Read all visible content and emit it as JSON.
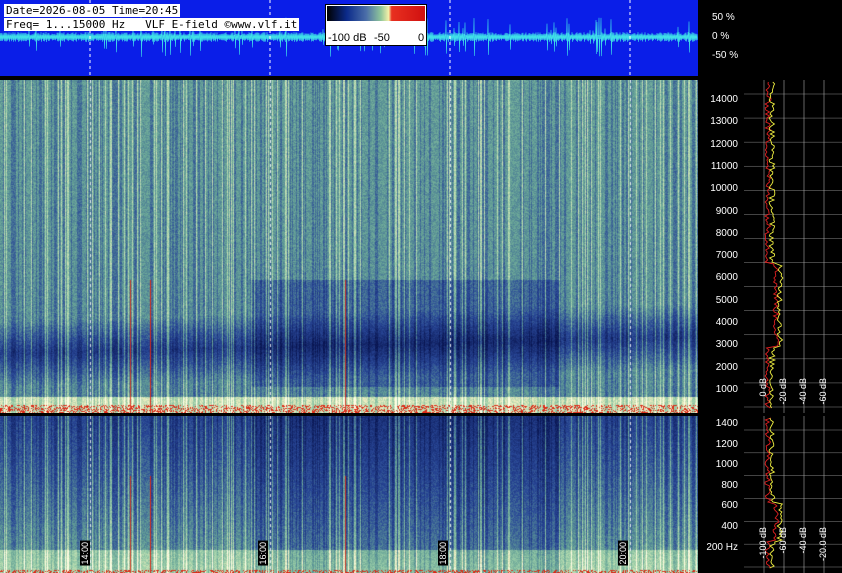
{
  "header": {
    "line1": "Date=2026-08-05 Time=20:45",
    "line2": "Freq= 1...15000 Hz   VLF E-field ©www.vlf.it"
  },
  "colorbar": {
    "labels": [
      "-100 dB",
      "-50",
      "0"
    ]
  },
  "waveform": {
    "scale_labels": [
      "50 %",
      "0 %",
      "-50 %"
    ]
  },
  "top_spectrogram": {
    "freq_ticks": [
      "14000",
      "13000",
      "12000",
      "11000",
      "10000",
      "9000",
      "8000",
      "7000",
      "6000",
      "5000",
      "4000",
      "3000",
      "2000",
      "1000"
    ],
    "db_labels": [
      "0 dB",
      "-20 dB",
      "-40 dB",
      "-60 dB",
      "-20.0 dB"
    ]
  },
  "bottom_spectrogram": {
    "freq_ticks": [
      "1400",
      "1200",
      "1000",
      "800",
      "600",
      "400",
      "200 Hz"
    ],
    "db_labels": [
      "-100 dB",
      "-60 dB",
      "-40 dB",
      "-20.0 dB"
    ]
  },
  "time_labels": [
    "14:00",
    "16:00",
    "18:00",
    "20:00"
  ],
  "colors": {
    "background": "#000000",
    "waveform_bg": "#0a1ee8",
    "waveform_trace": "#3fe0e8",
    "grid": "#ffffff",
    "trace_red": "#e02020",
    "trace_yellow": "#f0f040"
  }
}
